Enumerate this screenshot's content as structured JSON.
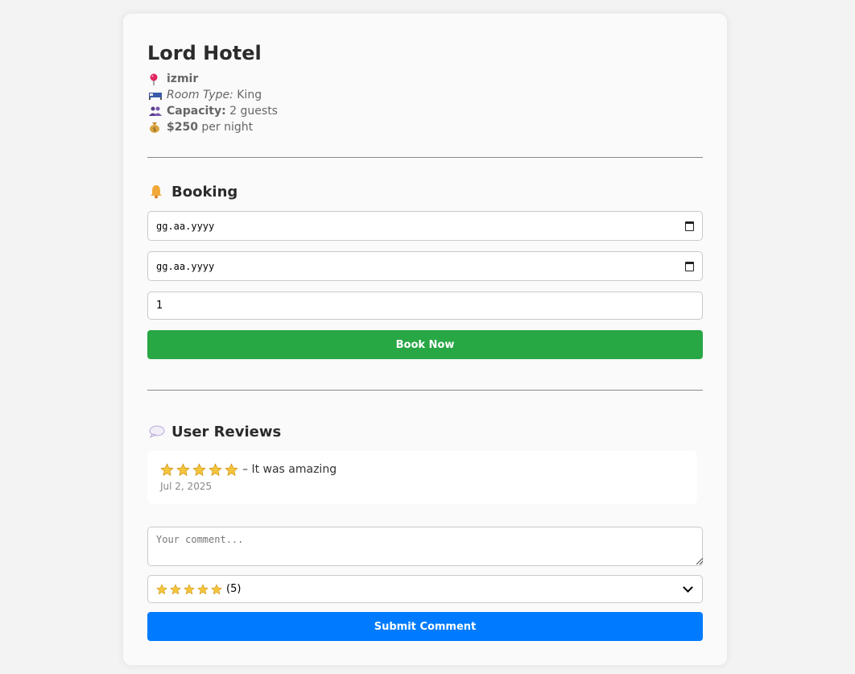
{
  "hotel": {
    "name": "Lord Hotel",
    "location": "izmir",
    "room_type_label": "Room Type:",
    "room_type": "King",
    "capacity_label": "Capacity:",
    "capacity": "2 guests",
    "price": "$250",
    "price_suffix": "per night",
    "icons": [
      "pin-icon",
      "bed-icon",
      "guests-icon",
      "money-bag-icon"
    ]
  },
  "booking": {
    "title": "Booking",
    "title_icon": "bell-icon",
    "checkin_placeholder": "gg.aa.yyyy",
    "checkout_placeholder": "gg.aa.yyyy",
    "guests_value": "1",
    "book_button": "Book Now",
    "book_color": "#28a745"
  },
  "reviews": {
    "title": "User Reviews",
    "title_icon": "speech-bubble-icon",
    "items": [
      {
        "stars": 5,
        "text": "– It was amazing",
        "date": "Jul 2, 2025"
      }
    ],
    "comment_placeholder": "Your comment...",
    "rating_select": {
      "selected_stars": 5,
      "selected_text": "(5)"
    },
    "submit_button": "Submit Comment",
    "submit_color": "#007bff"
  }
}
